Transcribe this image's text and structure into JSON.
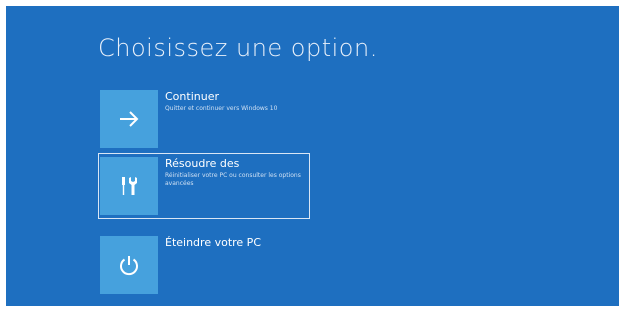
{
  "page": {
    "title": "Choisissez une option."
  },
  "options": [
    {
      "title": "Continuer",
      "description": "Quitter et continuer vers Windows 10",
      "icon": "arrow-right-icon",
      "selected": false
    },
    {
      "title": "Résoudre des",
      "description": "Réinitialiser votre PC ou consulter les options avancées",
      "icon": "tools-icon",
      "selected": true
    },
    {
      "title": "Éteindre votre PC",
      "description": "",
      "icon": "power-icon",
      "selected": false
    }
  ],
  "colors": {
    "background": "#1e6fc0",
    "tile": "#46a1dd",
    "text": "#ffffff",
    "selection_border": "#d9e6f5"
  }
}
